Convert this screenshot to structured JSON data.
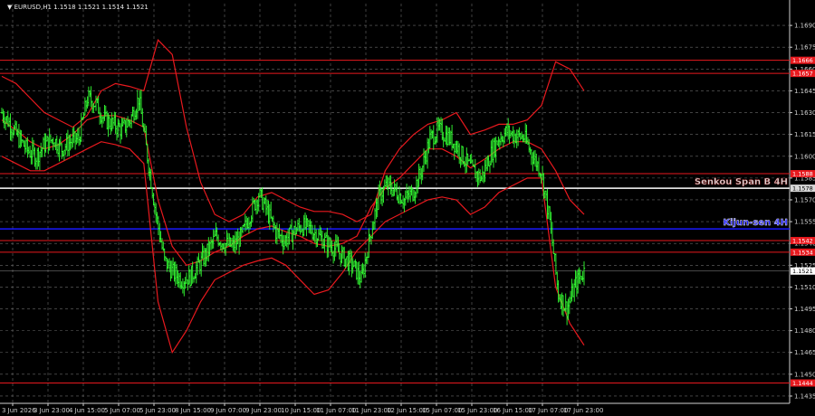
{
  "chart_data": {
    "type": "candlestick",
    "symbol_header": "EURUSD,H1  1.1518 1.1521 1.1514 1.1521",
    "ylim": [
      1.143,
      1.1705
    ],
    "y_ticks": [
      "1.1690",
      "1.1675",
      "1.1660",
      "1.1645",
      "1.1630",
      "1.1615",
      "1.1600",
      "1.1585",
      "1.1570",
      "1.1555",
      "1.1540",
      "1.1525",
      "1.1510",
      "1.1495",
      "1.1480",
      "1.1465",
      "1.1450",
      "1.1435"
    ],
    "x_ticks": [
      "3 Jun 2026",
      "3 Jun 23:00",
      "4 Jun 15:00",
      "5 Jun 07:00",
      "5 Jun 23:00",
      "8 Jun 15:00",
      "9 Jun 07:00",
      "9 Jun 23:00",
      "10 Jun 15:00",
      "11 Jun 07:00",
      "11 Jun 23:00",
      "12 Jun 15:00",
      "15 Jun 07:00",
      "15 Jun 23:00",
      "16 Jun 15:00",
      "17 Jun 07:00",
      "17 Jun 23:00"
    ],
    "current_price": "1.1521",
    "levels": [
      {
        "price": 1.1666,
        "tag": "1.1666",
        "color": "#e8191e"
      },
      {
        "price": 1.1657,
        "tag": "1.1657",
        "color": "#e8191e"
      },
      {
        "price": 1.1588,
        "tag": "1.1588",
        "color": "#e8191e"
      },
      {
        "price": 1.1578,
        "tag": "1.1578",
        "color": "#ffffff",
        "label": "Senkou Span B 4H"
      },
      {
        "price": 1.155,
        "tag": "",
        "color": "#1a1aff",
        "label": "Kijun-sen 4H"
      },
      {
        "price": 1.1542,
        "tag": "1.1542",
        "color": "#e8191e"
      },
      {
        "price": 1.1534,
        "tag": "1.1534",
        "color": "#e8191e"
      },
      {
        "price": 1.1444,
        "tag": "1.1444",
        "color": "#e8191e"
      }
    ],
    "close_series": [
      1.163,
      1.1622,
      1.1612,
      1.1604,
      1.16,
      1.1608,
      1.1612,
      1.1605,
      1.161,
      1.1612,
      1.164,
      1.1636,
      1.1625,
      1.1622,
      1.1618,
      1.1625,
      1.164,
      1.16,
      1.156,
      1.1528,
      1.152,
      1.1515,
      1.1517,
      1.1525,
      1.1534,
      1.1545,
      1.154,
      1.1538,
      1.1545,
      1.156,
      1.1574,
      1.1562,
      1.1548,
      1.1542,
      1.1548,
      1.1552,
      1.155,
      1.1545,
      1.154,
      1.1536,
      1.153,
      1.1525,
      1.1515,
      1.1545,
      1.1572,
      1.158,
      1.1576,
      1.157,
      1.1575,
      1.159,
      1.1612,
      1.1618,
      1.1614,
      1.1608,
      1.1598,
      1.159,
      1.1585,
      1.16,
      1.1612,
      1.1617,
      1.1614,
      1.1613,
      1.16,
      1.159,
      1.1555,
      1.1505,
      1.1495,
      1.1512,
      1.1521
    ],
    "bollinger": {
      "upper": [
        1.1655,
        1.165,
        1.164,
        1.163,
        1.1625,
        1.162,
        1.1628,
        1.1645,
        1.165,
        1.1648,
        1.1645,
        1.168,
        1.167,
        1.162,
        1.1582,
        1.156,
        1.1555,
        1.156,
        1.1572,
        1.1575,
        1.157,
        1.1565,
        1.1562,
        1.1562,
        1.156,
        1.1555,
        1.156,
        1.159,
        1.1605,
        1.1615,
        1.1622,
        1.1625,
        1.163,
        1.1615,
        1.1618,
        1.1622,
        1.1622,
        1.1625,
        1.1635,
        1.1665,
        1.166,
        1.1645
      ],
      "middle": [
        1.1625,
        1.1618,
        1.161,
        1.1605,
        1.1608,
        1.1615,
        1.1625,
        1.1628,
        1.1628,
        1.1625,
        1.162,
        1.157,
        1.1538,
        1.1525,
        1.1528,
        1.1534,
        1.1538,
        1.1545,
        1.155,
        1.1552,
        1.1548,
        1.1545,
        1.154,
        1.1538,
        1.154,
        1.1545,
        1.1565,
        1.1578,
        1.1585,
        1.1595,
        1.1605,
        1.1605,
        1.16,
        1.1592,
        1.1598,
        1.1605,
        1.161,
        1.161,
        1.1605,
        1.159,
        1.157,
        1.156
      ],
      "lower": [
        1.16,
        1.1595,
        1.159,
        1.159,
        1.1595,
        1.16,
        1.1605,
        1.161,
        1.1608,
        1.1605,
        1.1595,
        1.15,
        1.1465,
        1.148,
        1.15,
        1.1515,
        1.152,
        1.1525,
        1.1528,
        1.153,
        1.1525,
        1.1515,
        1.1505,
        1.1508,
        1.152,
        1.1535,
        1.1545,
        1.1555,
        1.156,
        1.1565,
        1.157,
        1.1572,
        1.157,
        1.156,
        1.1565,
        1.1575,
        1.158,
        1.1585,
        1.1585,
        1.151,
        1.1485,
        1.147
      ]
    }
  }
}
